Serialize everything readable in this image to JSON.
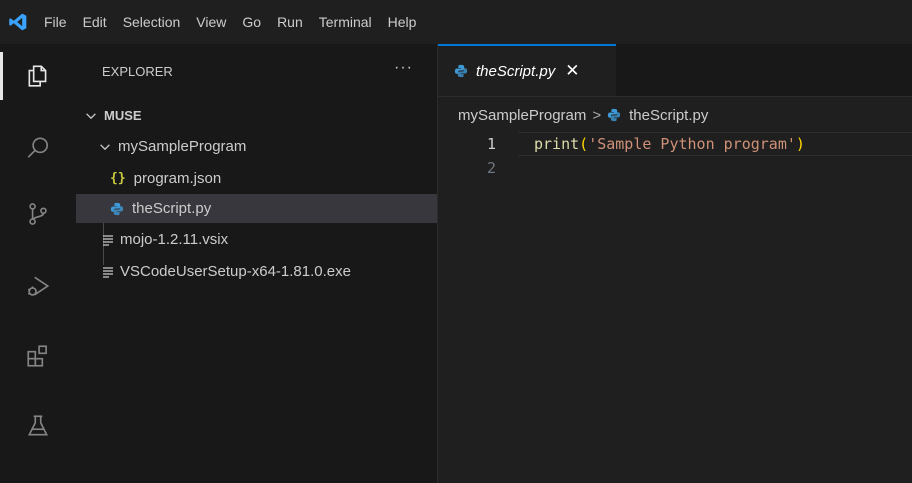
{
  "menubar": {
    "items": [
      "File",
      "Edit",
      "Selection",
      "View",
      "Go",
      "Run",
      "Terminal",
      "Help"
    ]
  },
  "activitybar": {
    "icons": [
      "explorer-icon",
      "search-icon",
      "source-control-icon",
      "run-debug-icon",
      "extensions-icon",
      "testing-icon"
    ],
    "active": "explorer-icon"
  },
  "sidebar": {
    "header": "EXPLORER",
    "more": "···",
    "root": "MUSE",
    "tree": [
      {
        "label": "mySampleProgram",
        "type": "folder",
        "depth": 1
      },
      {
        "label": "program.json",
        "type": "json",
        "icon_text": "{}",
        "depth": 2
      },
      {
        "label": "theScript.py",
        "type": "python",
        "depth": 2,
        "selected": true
      },
      {
        "label": "mojo-1.2.11.vsix",
        "type": "file",
        "depth": 1
      },
      {
        "label": "VSCodeUserSetup-x64-1.81.0.exe",
        "type": "file",
        "depth": 1
      }
    ]
  },
  "editor": {
    "tab": {
      "label": "theScript.py",
      "close": "✕"
    },
    "breadcrumb": {
      "folder": "mySampleProgram",
      "sep": ">",
      "file": "theScript.py"
    },
    "lines": [
      {
        "number": "1",
        "fn": "print",
        "open": "(",
        "string": "'Sample Python program'",
        "close": ")"
      },
      {
        "number": "2"
      }
    ]
  },
  "colors": {
    "accent": "#0078d4",
    "python_icon": "#3e9ad6",
    "json_icon": "#cbcb41"
  }
}
